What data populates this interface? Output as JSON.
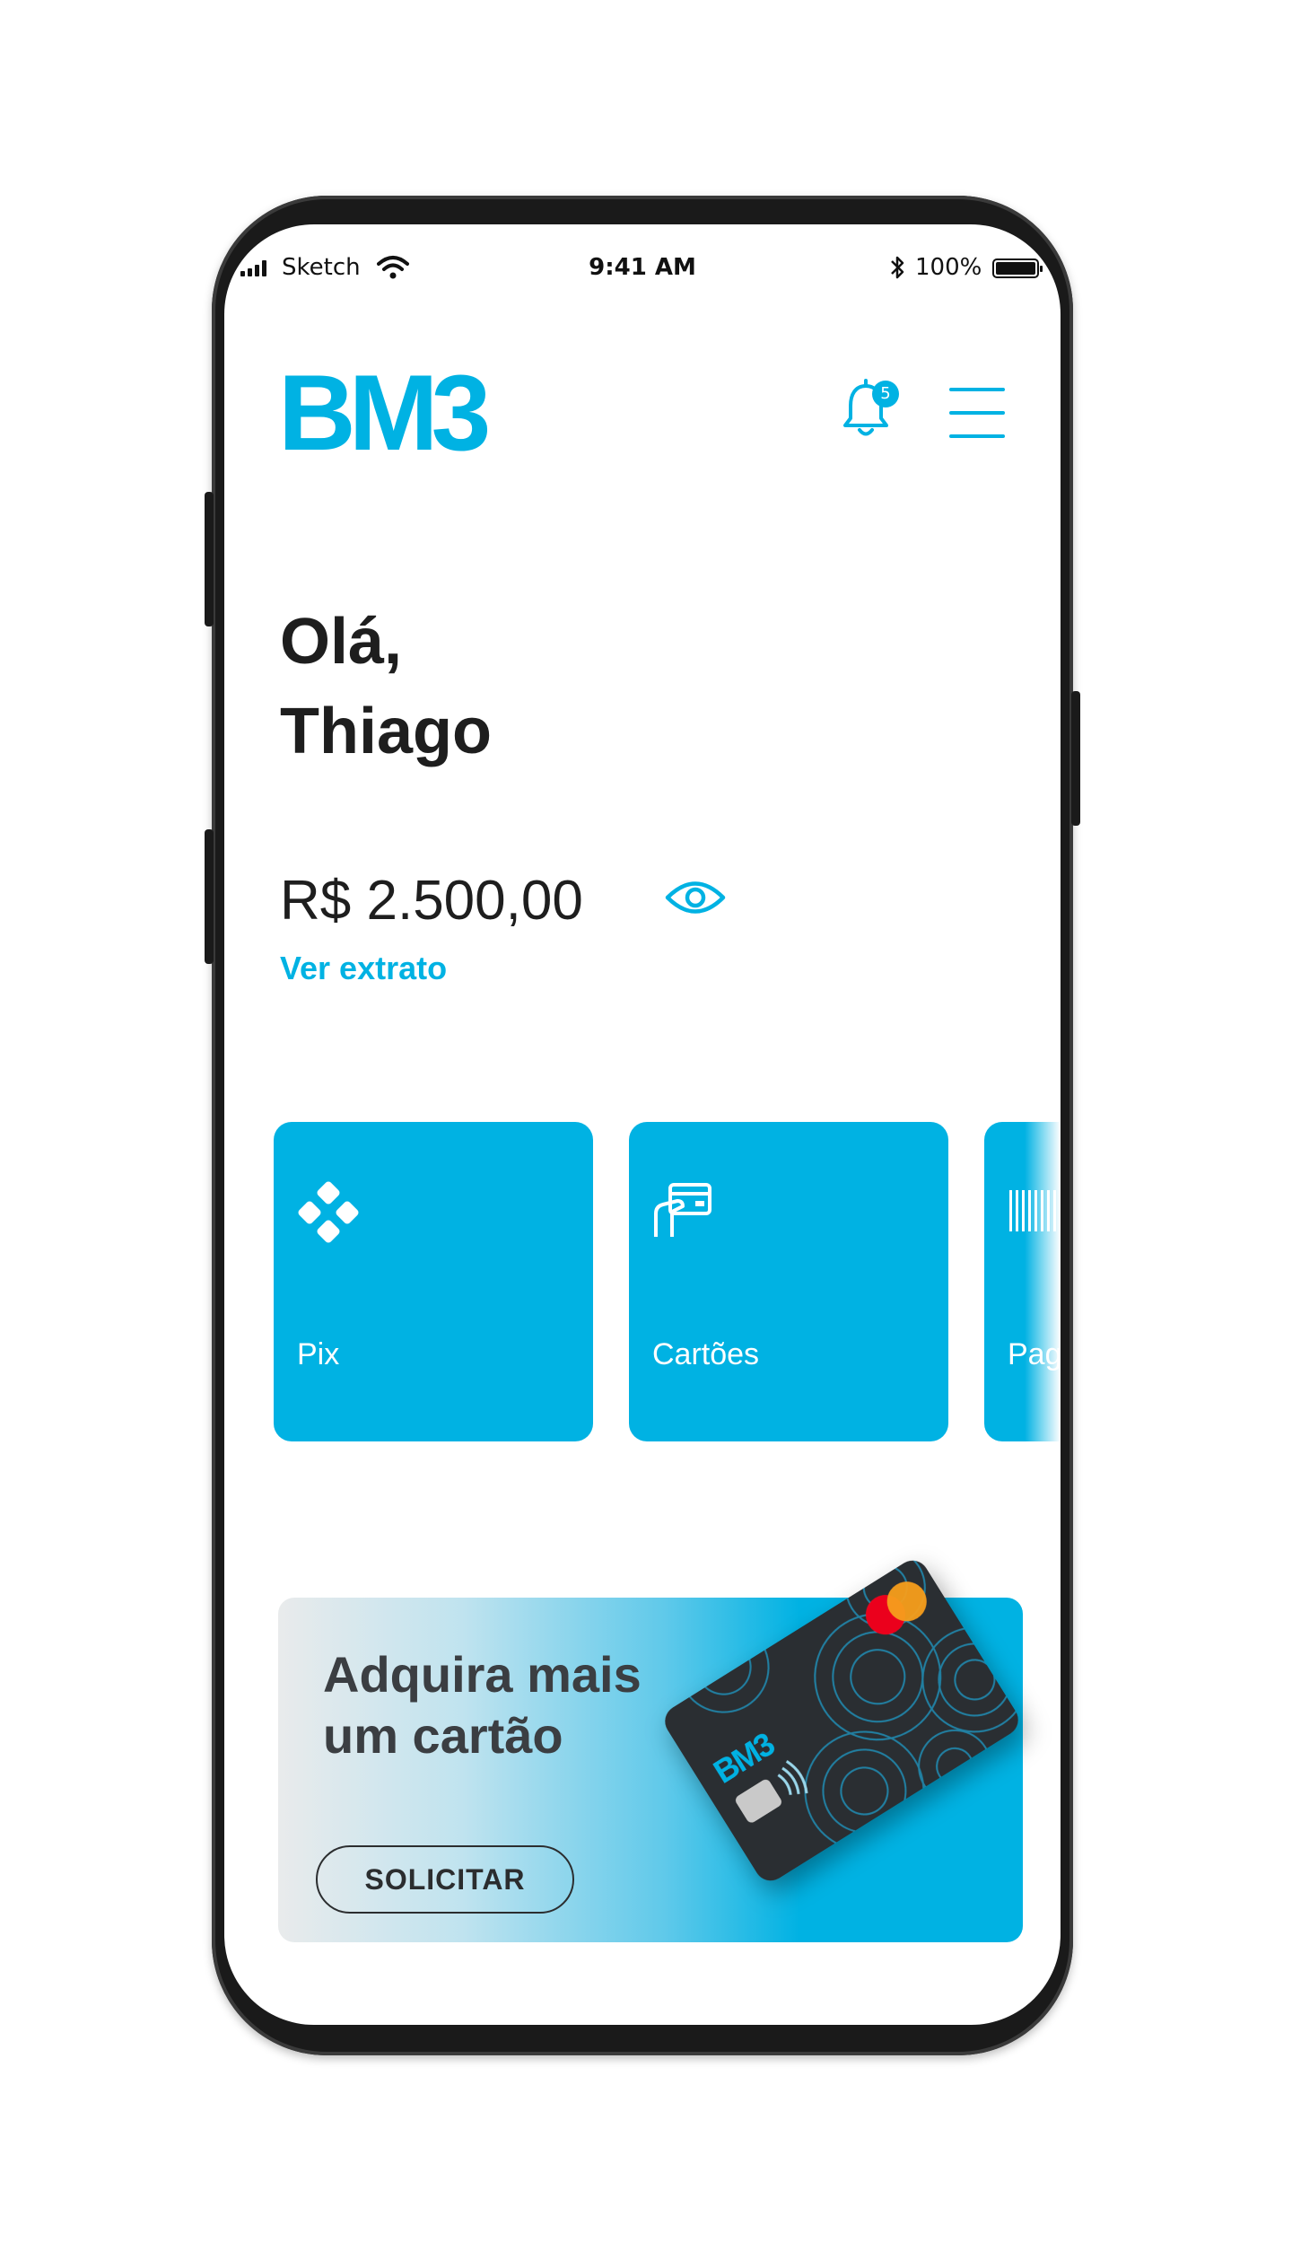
{
  "status_bar": {
    "carrier": "Sketch",
    "time": "9:41 AM",
    "battery": "100%",
    "battery_level": 1.0
  },
  "header": {
    "logo": "BM3",
    "notification_count": "5",
    "icons": [
      "bell-icon",
      "menu-icon"
    ]
  },
  "greeting": {
    "line1": "Olá,",
    "line2": "Thiago"
  },
  "account": {
    "balance": "R$ 2.500,00",
    "statement_link": "Ver extrato",
    "visibility_icon": "eye-icon"
  },
  "actions": [
    {
      "label": "Pix",
      "icon": "pix-icon"
    },
    {
      "label": "Cartões",
      "icon": "card-in-hand-icon"
    },
    {
      "label": "Paga",
      "icon": "barcode-icon"
    }
  ],
  "promo": {
    "title": "Adquira mais um cartão",
    "button": "SOLICITAR",
    "card_brand": "BM3"
  },
  "colors": {
    "accent": "#00b2e3",
    "text_dark": "#1e1e1e",
    "card_black": "#2a2d31",
    "mastercard_red": "#eb001b",
    "mastercard_orange": "#f79e1b"
  }
}
